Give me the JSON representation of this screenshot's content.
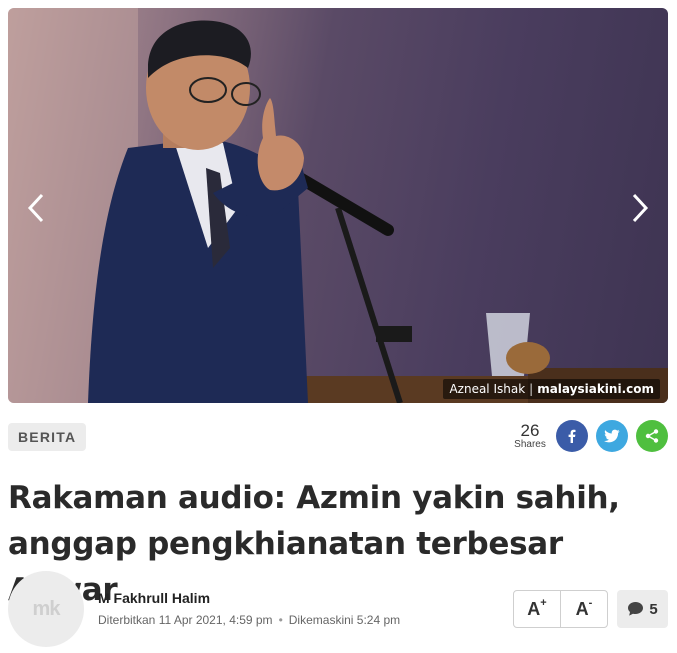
{
  "hero": {
    "photo_credit_name": "Azneal Ishak",
    "photo_credit_separator": "|",
    "photo_credit_brand": "malaysiakini.com"
  },
  "meta": {
    "category": "BERITA",
    "share_count": "26",
    "share_label": "Shares",
    "colors": {
      "facebook": "#3b5ca8",
      "twitter": "#3ea8e0",
      "share": "#4fbf3f"
    }
  },
  "article": {
    "headline": "Rakaman audio: Azmin yakin sahih, anggap pengkhianatan terbesar Anwar",
    "author": "M Fakhrull Halim",
    "published": "Diterbitkan 11 Apr 2021, 4:59 pm",
    "updated": "Dikemaskini 5:24 pm",
    "avatar_initials": "mk"
  },
  "controls": {
    "font_increase": "A",
    "font_increase_sup": "+",
    "font_decrease": "A",
    "font_decrease_sup": "-",
    "comment_count": "5"
  }
}
